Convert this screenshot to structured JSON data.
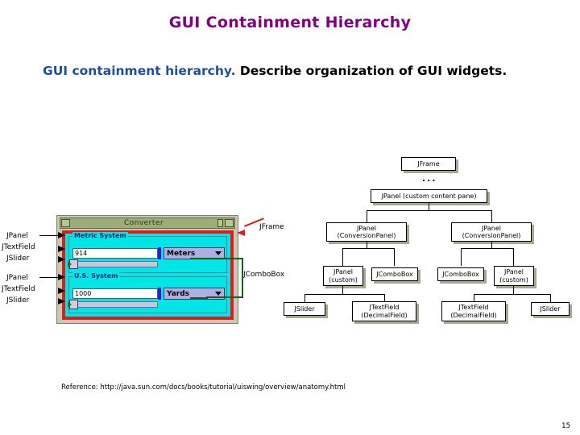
{
  "slide": {
    "title": "GUI Containment Hierarchy",
    "bullet": {
      "emphasis": "GUI containment hierarchy.",
      "rest": "Describe organization of GUI widgets."
    },
    "reference": "Reference: http://java.sun.com/docs/books/tutorial/uiswing/overview/anatomy.html",
    "page_number": "15"
  },
  "colors": {
    "title": "#800080",
    "bullet_emphasis": "#1f4e9c",
    "bullet_rest": "#000000",
    "app_panel_bg": "#00e5e5",
    "frame_highlight": "#e01b1b",
    "combobox_bracket": "#1d5c1d",
    "titlebar": "#9aae76",
    "node_shadow": "#a8a890"
  },
  "app_screenshot": {
    "window_title": "Converter",
    "titlebar_buttons": {
      "left": "minimize-button",
      "right_small": "restore-button",
      "right_large": "maximize-button"
    },
    "panels": [
      {
        "legend": "Metric System",
        "textfield_value": "914",
        "combobox_value": "Meters"
      },
      {
        "legend": "U.S. System",
        "textfield_value": "1000",
        "combobox_value": "Yards"
      }
    ]
  },
  "callouts": {
    "left": [
      {
        "label": "JPanel"
      },
      {
        "label": "JTextField"
      },
      {
        "label": "JSlider"
      },
      {
        "label": "JPanel"
      },
      {
        "label": "JTextField"
      },
      {
        "label": "JSlider"
      }
    ],
    "right": [
      {
        "label": "JFrame"
      },
      {
        "label": "JComboBox"
      }
    ]
  },
  "tree": {
    "ellipsis": "...",
    "nodes": [
      {
        "id": "jframe",
        "lines": [
          "JFrame"
        ]
      },
      {
        "id": "content-pane",
        "lines": [
          "JPanel (custom content pane)"
        ]
      },
      {
        "id": "conv-left",
        "lines": [
          "JPanel",
          "(ConversionPanel)"
        ]
      },
      {
        "id": "conv-right",
        "lines": [
          "JPanel",
          "(ConversionPanel)"
        ]
      },
      {
        "id": "custom-left",
        "lines": [
          "JPanel",
          "(custom)"
        ]
      },
      {
        "id": "combo-left",
        "lines": [
          "JComboBox"
        ]
      },
      {
        "id": "combo-right",
        "lines": [
          "JComboBox"
        ]
      },
      {
        "id": "custom-right",
        "lines": [
          "JPanel",
          "(custom)"
        ]
      },
      {
        "id": "slider-left",
        "lines": [
          "JSlider"
        ]
      },
      {
        "id": "tf-left",
        "lines": [
          "JTextField",
          "(DecimalField)"
        ]
      },
      {
        "id": "tf-right",
        "lines": [
          "JTextField",
          "(DecimalField)"
        ]
      },
      {
        "id": "slider-right",
        "lines": [
          "JSlider"
        ]
      }
    ]
  }
}
